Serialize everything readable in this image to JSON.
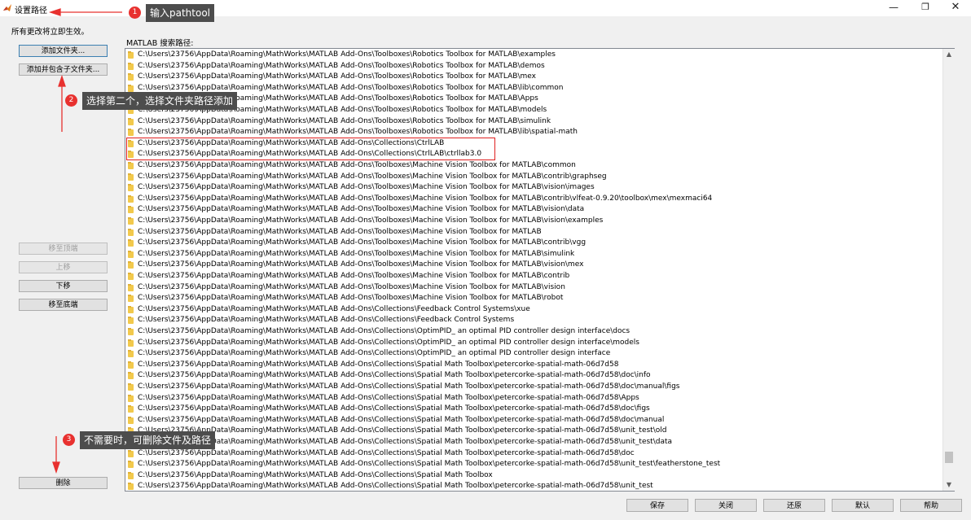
{
  "window": {
    "title": "设置路径",
    "icon": "matlab-icon",
    "controls": [
      "minimize-icon",
      "maximize-icon",
      "close-icon"
    ]
  },
  "notice": "所有更改将立即生效。",
  "path_label": "MATLAB 搜索路径:",
  "side_buttons": {
    "add_folder": "添加文件夹...",
    "add_with_subfolders": "添加并包含子文件夹...",
    "move_to_top": "移至顶端",
    "move_up": "上移",
    "move_down": "下移",
    "move_to_bottom": "移至底端",
    "remove": "删除"
  },
  "footer_buttons": {
    "save": "保存",
    "close": "关闭",
    "revert": "还原",
    "default": "默认",
    "help": "帮助"
  },
  "paths": [
    "C:\\Users\\23756\\AppData\\Roaming\\MathWorks\\MATLAB Add-Ons\\Toolboxes\\Robotics Toolbox for MATLAB\\examples",
    "C:\\Users\\23756\\AppData\\Roaming\\MathWorks\\MATLAB Add-Ons\\Toolboxes\\Robotics Toolbox for MATLAB\\demos",
    "C:\\Users\\23756\\AppData\\Roaming\\MathWorks\\MATLAB Add-Ons\\Toolboxes\\Robotics Toolbox for MATLAB\\mex",
    "C:\\Users\\23756\\AppData\\Roaming\\MathWorks\\MATLAB Add-Ons\\Toolboxes\\Robotics Toolbox for MATLAB\\lib\\common",
    "C:\\Users\\23756\\AppData\\Roaming\\MathWorks\\MATLAB Add-Ons\\Toolboxes\\Robotics Toolbox for MATLAB\\Apps",
    "C:\\Users\\23756\\AppData\\Roaming\\MathWorks\\MATLAB Add-Ons\\Toolboxes\\Robotics Toolbox for MATLAB\\models",
    "C:\\Users\\23756\\AppData\\Roaming\\MathWorks\\MATLAB Add-Ons\\Toolboxes\\Robotics Toolbox for MATLAB\\simulink",
    "C:\\Users\\23756\\AppData\\Roaming\\MathWorks\\MATLAB Add-Ons\\Toolboxes\\Robotics Toolbox for MATLAB\\lib\\spatial-math",
    "C:\\Users\\23756\\AppData\\Roaming\\MathWorks\\MATLAB Add-Ons\\Collections\\CtrlLAB",
    "C:\\Users\\23756\\AppData\\Roaming\\MathWorks\\MATLAB Add-Ons\\Collections\\CtrlLAB\\ctrllab3.0",
    "C:\\Users\\23756\\AppData\\Roaming\\MathWorks\\MATLAB Add-Ons\\Toolboxes\\Machine Vision Toolbox for MATLAB\\common",
    "C:\\Users\\23756\\AppData\\Roaming\\MathWorks\\MATLAB Add-Ons\\Toolboxes\\Machine Vision Toolbox for MATLAB\\contrib\\graphseg",
    "C:\\Users\\23756\\AppData\\Roaming\\MathWorks\\MATLAB Add-Ons\\Toolboxes\\Machine Vision Toolbox for MATLAB\\vision\\images",
    "C:\\Users\\23756\\AppData\\Roaming\\MathWorks\\MATLAB Add-Ons\\Toolboxes\\Machine Vision Toolbox for MATLAB\\contrib\\vlfeat-0.9.20\\toolbox\\mex\\mexmaci64",
    "C:\\Users\\23756\\AppData\\Roaming\\MathWorks\\MATLAB Add-Ons\\Toolboxes\\Machine Vision Toolbox for MATLAB\\vision\\data",
    "C:\\Users\\23756\\AppData\\Roaming\\MathWorks\\MATLAB Add-Ons\\Toolboxes\\Machine Vision Toolbox for MATLAB\\vision\\examples",
    "C:\\Users\\23756\\AppData\\Roaming\\MathWorks\\MATLAB Add-Ons\\Toolboxes\\Machine Vision Toolbox for MATLAB",
    "C:\\Users\\23756\\AppData\\Roaming\\MathWorks\\MATLAB Add-Ons\\Toolboxes\\Machine Vision Toolbox for MATLAB\\contrib\\vgg",
    "C:\\Users\\23756\\AppData\\Roaming\\MathWorks\\MATLAB Add-Ons\\Toolboxes\\Machine Vision Toolbox for MATLAB\\simulink",
    "C:\\Users\\23756\\AppData\\Roaming\\MathWorks\\MATLAB Add-Ons\\Toolboxes\\Machine Vision Toolbox for MATLAB\\vision\\mex",
    "C:\\Users\\23756\\AppData\\Roaming\\MathWorks\\MATLAB Add-Ons\\Toolboxes\\Machine Vision Toolbox for MATLAB\\contrib",
    "C:\\Users\\23756\\AppData\\Roaming\\MathWorks\\MATLAB Add-Ons\\Toolboxes\\Machine Vision Toolbox for MATLAB\\vision",
    "C:\\Users\\23756\\AppData\\Roaming\\MathWorks\\MATLAB Add-Ons\\Toolboxes\\Machine Vision Toolbox for MATLAB\\robot",
    "C:\\Users\\23756\\AppData\\Roaming\\MathWorks\\MATLAB Add-Ons\\Collections\\Feedback Control Systems\\xue",
    "C:\\Users\\23756\\AppData\\Roaming\\MathWorks\\MATLAB Add-Ons\\Collections\\Feedback Control Systems",
    "C:\\Users\\23756\\AppData\\Roaming\\MathWorks\\MATLAB Add-Ons\\Collections\\OptimPID_ an optimal PID controller design interface\\docs",
    "C:\\Users\\23756\\AppData\\Roaming\\MathWorks\\MATLAB Add-Ons\\Collections\\OptimPID_ an optimal PID controller design interface\\models",
    "C:\\Users\\23756\\AppData\\Roaming\\MathWorks\\MATLAB Add-Ons\\Collections\\OptimPID_ an optimal PID controller design interface",
    "C:\\Users\\23756\\AppData\\Roaming\\MathWorks\\MATLAB Add-Ons\\Collections\\Spatial Math Toolbox\\petercorke-spatial-math-06d7d58",
    "C:\\Users\\23756\\AppData\\Roaming\\MathWorks\\MATLAB Add-Ons\\Collections\\Spatial Math Toolbox\\petercorke-spatial-math-06d7d58\\doc\\info",
    "C:\\Users\\23756\\AppData\\Roaming\\MathWorks\\MATLAB Add-Ons\\Collections\\Spatial Math Toolbox\\petercorke-spatial-math-06d7d58\\doc\\manual\\figs",
    "C:\\Users\\23756\\AppData\\Roaming\\MathWorks\\MATLAB Add-Ons\\Collections\\Spatial Math Toolbox\\petercorke-spatial-math-06d7d58\\Apps",
    "C:\\Users\\23756\\AppData\\Roaming\\MathWorks\\MATLAB Add-Ons\\Collections\\Spatial Math Toolbox\\petercorke-spatial-math-06d7d58\\doc\\figs",
    "C:\\Users\\23756\\AppData\\Roaming\\MathWorks\\MATLAB Add-Ons\\Collections\\Spatial Math Toolbox\\petercorke-spatial-math-06d7d58\\doc\\manual",
    "C:\\Users\\23756\\AppData\\Roaming\\MathWorks\\MATLAB Add-Ons\\Collections\\Spatial Math Toolbox\\petercorke-spatial-math-06d7d58\\unit_test\\old",
    "C:\\Users\\23756\\AppData\\Roaming\\MathWorks\\MATLAB Add-Ons\\Collections\\Spatial Math Toolbox\\petercorke-spatial-math-06d7d58\\unit_test\\data",
    "C:\\Users\\23756\\AppData\\Roaming\\MathWorks\\MATLAB Add-Ons\\Collections\\Spatial Math Toolbox\\petercorke-spatial-math-06d7d58\\doc",
    "C:\\Users\\23756\\AppData\\Roaming\\MathWorks\\MATLAB Add-Ons\\Collections\\Spatial Math Toolbox\\petercorke-spatial-math-06d7d58\\unit_test\\featherstone_test",
    "C:\\Users\\23756\\AppData\\Roaming\\MathWorks\\MATLAB Add-Ons\\Collections\\Spatial Math Toolbox",
    "C:\\Users\\23756\\AppData\\Roaming\\MathWorks\\MATLAB Add-Ons\\Collections\\Spatial Math Toolbox\\petercorke-spatial-math-06d7d58\\unit_test"
  ],
  "highlighted_rows": [
    8,
    9
  ],
  "scroll": {
    "position": 0.96
  },
  "annotations": [
    {
      "number": "1",
      "text": "输入pathtool"
    },
    {
      "number": "2",
      "text": "选择第二个，选择文件夹路径添加"
    },
    {
      "number": "3",
      "text": "不需要时，可删除文件及路径"
    }
  ],
  "colors": {
    "highlight_box": "#e02020",
    "badge": "#e8312f",
    "tooltip_bg": "#4d4d4d",
    "folder": "#f2c94c"
  }
}
